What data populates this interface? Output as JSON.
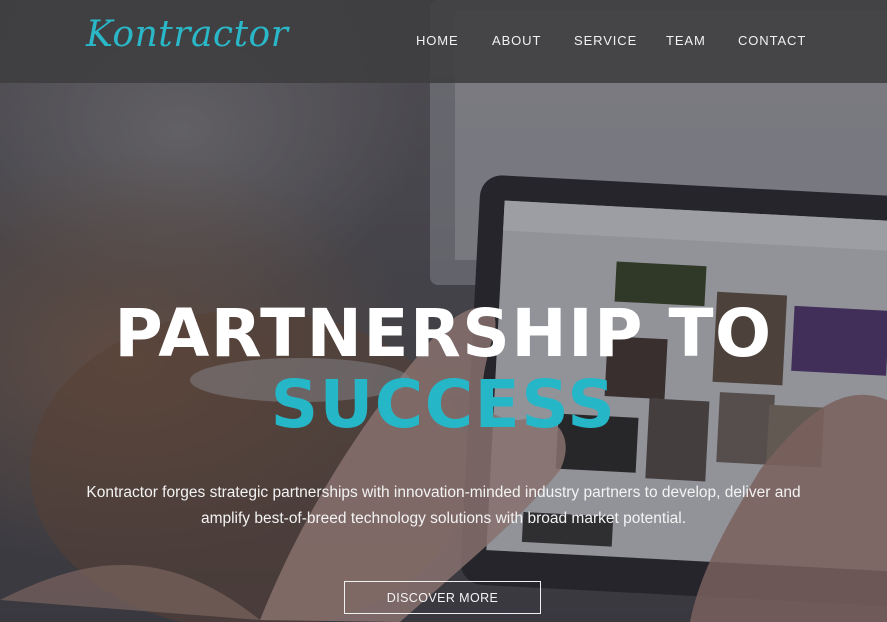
{
  "brand": {
    "logo_text": "Kontractor",
    "accent_color": "#25b7c8"
  },
  "nav": {
    "items": [
      "HOME",
      "ABOUT",
      "SERVICE",
      "TEAM",
      "CONTACT"
    ]
  },
  "hero": {
    "title_line1": "PARTNERSHIP TO",
    "title_line2": "SUCCESS",
    "description": "Kontractor forges strategic partnerships with innovation-minded industry partners to develop, deliver and amplify best-of-breed technology solutions with broad market potential.",
    "cta_label": "DISCOVER MORE",
    "background_image": "hands-using-tablet-photo"
  }
}
